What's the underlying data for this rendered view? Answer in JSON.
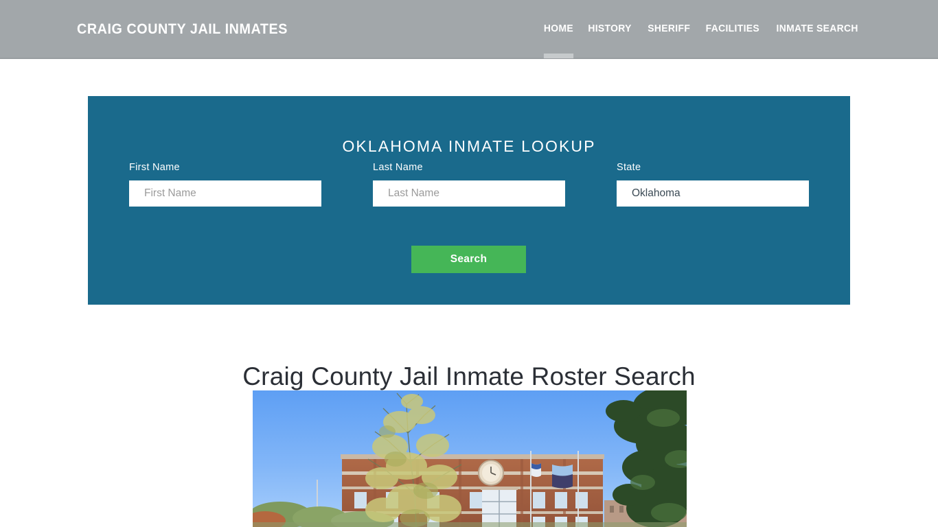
{
  "header": {
    "logo": "CRAIG COUNTY JAIL INMATES",
    "nav": [
      {
        "label": "HOME",
        "active": true
      },
      {
        "label": "HISTORY",
        "active": false
      },
      {
        "label": "SHERIFF",
        "active": false
      },
      {
        "label": "FACILITIES",
        "active": false
      },
      {
        "label": "INMATE SEARCH",
        "active": false
      }
    ],
    "bg_color": "#a2a7aa",
    "text_color": "#ffffff",
    "active_indicator_color": "#c6cacc"
  },
  "lookup": {
    "title": "OKLAHOMA INMATE LOOKUP",
    "panel_color": "#1a6a8c",
    "fields": {
      "first_name": {
        "label": "First Name",
        "placeholder": "First Name",
        "value": ""
      },
      "last_name": {
        "label": "Last Name",
        "placeholder": "Last Name",
        "value": ""
      },
      "state": {
        "label": "State",
        "value": "Oklahoma",
        "options": [
          "Oklahoma"
        ]
      }
    },
    "search_button": {
      "label": "Search",
      "color": "#45b657"
    }
  },
  "main": {
    "heading": "Craig County Jail Inmate Roster Search",
    "photo": {
      "alt": "Craig County Courthouse brick building with flagpoles and clock under blue sky",
      "sky_color": "#79b0f7",
      "brick_color": "#a8603f"
    }
  }
}
